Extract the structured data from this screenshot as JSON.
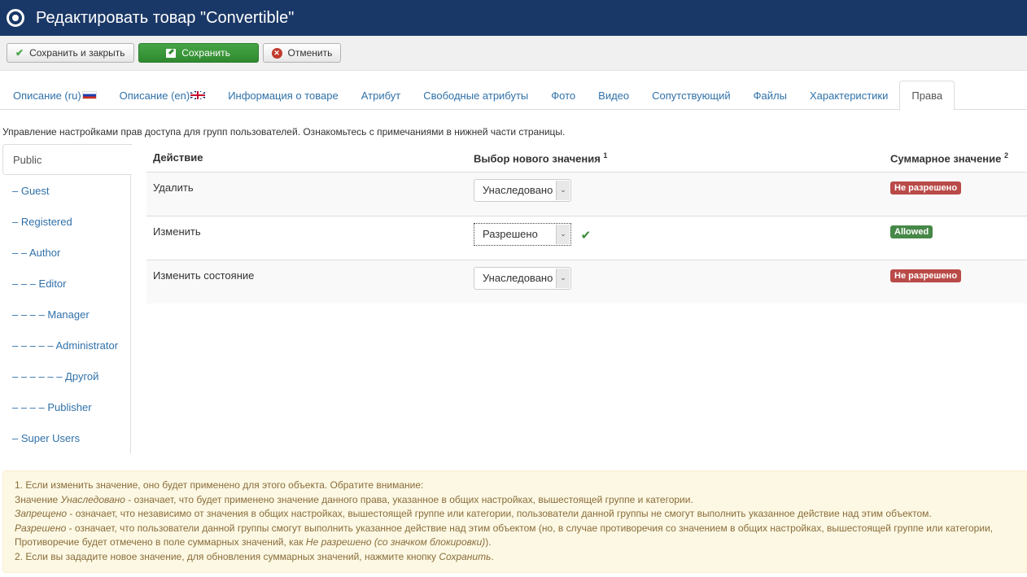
{
  "header": {
    "title": "Редактировать товар \"Convertible\""
  },
  "toolbar": {
    "save_close_label": "Сохранить и закрыть",
    "save_label": "Сохранить",
    "cancel_label": "Отменить"
  },
  "tabs": [
    {
      "label": "Описание (ru)",
      "flag": "ru"
    },
    {
      "label": "Описание (en)",
      "flag": "gb"
    },
    {
      "label": "Информация о товаре"
    },
    {
      "label": "Атрибут"
    },
    {
      "label": "Свободные атрибуты"
    },
    {
      "label": "Фото"
    },
    {
      "label": "Видео"
    },
    {
      "label": "Сопутствующий"
    },
    {
      "label": "Файлы"
    },
    {
      "label": "Характеристики"
    },
    {
      "label": "Права",
      "active": true
    }
  ],
  "intro": "Управление настройками прав доступа для групп пользователей. Ознакомьтесь с примечаниями в нижней части страницы.",
  "groups": [
    {
      "label": "Public",
      "active": true
    },
    {
      "label": "– Guest"
    },
    {
      "label": "– Registered"
    },
    {
      "label": "– – Author"
    },
    {
      "label": "– – – Editor"
    },
    {
      "label": "– – – – Manager"
    },
    {
      "label": "– – – – – Administrator"
    },
    {
      "label": "– – – – – – Другой"
    },
    {
      "label": "– – – – Publisher"
    },
    {
      "label": "– Super Users"
    }
  ],
  "table": {
    "headers": {
      "action": "Действие",
      "new_value": "Выбор нового значения",
      "new_value_note": "1",
      "calculated": "Суммарное значение",
      "calculated_note": "2"
    },
    "rows": [
      {
        "action": "Удалить",
        "value": "Унаследовано",
        "saved": false,
        "calculated": "Не разрешено",
        "status": "denied"
      },
      {
        "action": "Изменить",
        "value": "Разрешено",
        "saved": true,
        "calculated": "Allowed",
        "status": "allowed"
      },
      {
        "action": "Изменить состояние",
        "value": "Унаследовано",
        "saved": false,
        "calculated": "Не разрешено",
        "status": "denied"
      }
    ]
  },
  "notes": {
    "line1": "1. Если изменить значение, оно будет применено для этого объекта. Обратите внимание:",
    "line2_pre": "Значение ",
    "line2_em": "Унаследовано",
    "line2_post": " - означает, что будет применено значение данного права, указанное в общих настройках, вышестоящей группе и категории.",
    "line3_em": "Запрещено",
    "line3_post": " - означает, что независимо от значения в общих настройках, вышестоящей группе или категории, пользователи данной группы не смогут выполнить указанное действие над этим объектом.",
    "line4_em": "Разрешено",
    "line4_post": " - означает, что пользователи данной группы смогут выполнить указанное действие над этим объектом (но, в случае противоречия со значением в общих настройках, вышестоящей группе или категории,",
    "line5_pre": "Противоречие будет отмечено в поле суммарных значений, как ",
    "line5_em": "Не разрешено (со значком блокировки)",
    "line5_post": ").",
    "line6_pre": "2. Если вы зададите новое значение, для обновления суммарных значений, нажмите кнопку ",
    "line6_em": "Сохранить",
    "line6_post": "."
  }
}
